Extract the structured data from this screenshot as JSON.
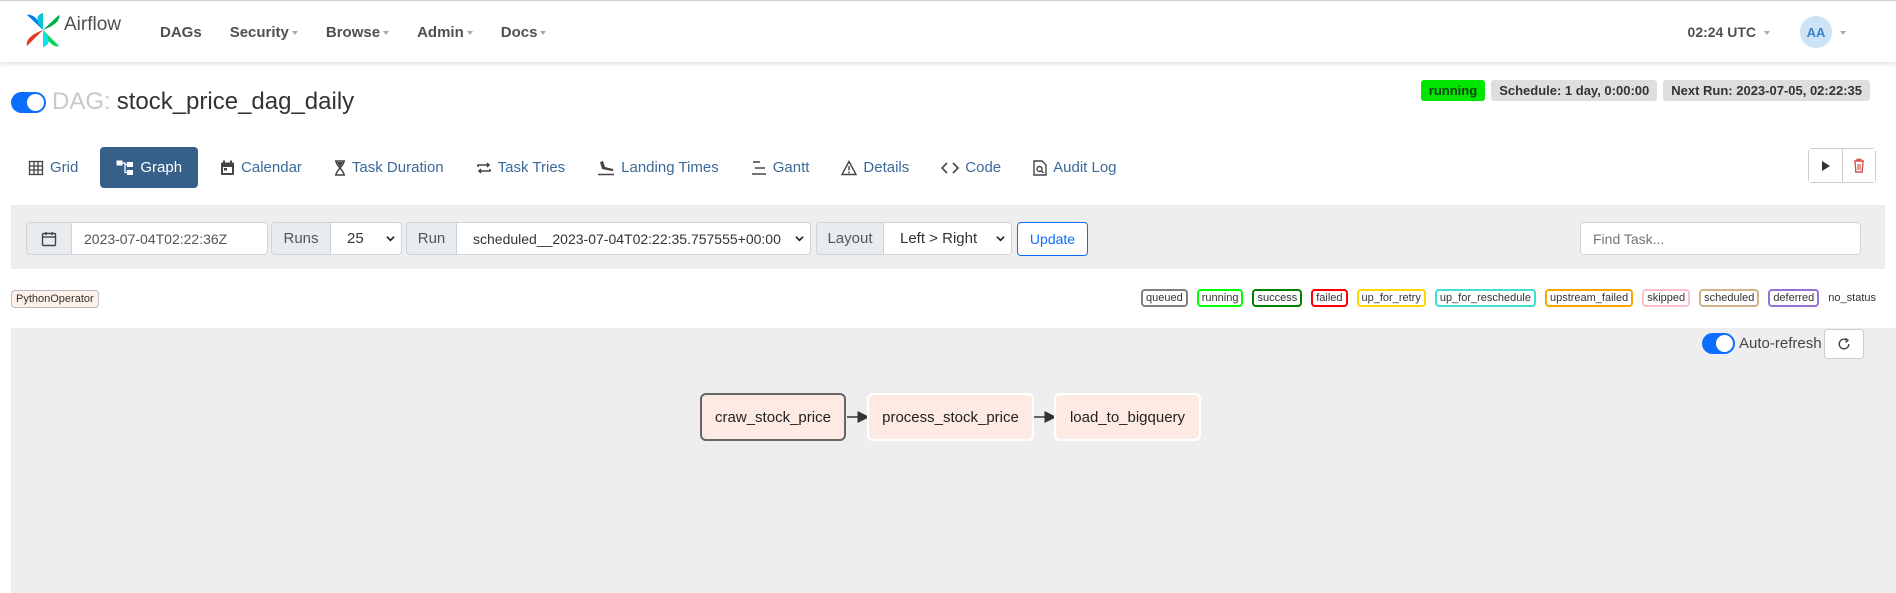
{
  "app": {
    "brand": "Airflow"
  },
  "nav": {
    "items": [
      {
        "label": "DAGs",
        "dropdown": false
      },
      {
        "label": "Security",
        "dropdown": true
      },
      {
        "label": "Browse",
        "dropdown": true
      },
      {
        "label": "Admin",
        "dropdown": true
      },
      {
        "label": "Docs",
        "dropdown": true
      }
    ],
    "clock": "02:24 UTC",
    "avatar_initials": "AA"
  },
  "dag": {
    "prefix": "DAG:",
    "name": "stock_price_dag_daily",
    "paused": false,
    "state_badge": "running",
    "schedule": "Schedule: 1 day, 0:00:00",
    "next_run": "Next Run: 2023-07-05, 02:22:35"
  },
  "tabs": [
    {
      "label": "Grid",
      "icon": "grid-icon",
      "active": false
    },
    {
      "label": "Graph",
      "icon": "graph-icon",
      "active": true
    },
    {
      "label": "Calendar",
      "icon": "calendar-icon",
      "active": false
    },
    {
      "label": "Task Duration",
      "icon": "hourglass-icon",
      "active": false
    },
    {
      "label": "Task Tries",
      "icon": "repeat-icon",
      "active": false
    },
    {
      "label": "Landing Times",
      "icon": "plane-landing-icon",
      "active": false
    },
    {
      "label": "Gantt",
      "icon": "gantt-icon",
      "active": false
    },
    {
      "label": "Details",
      "icon": "warning-triangle-icon",
      "active": false
    },
    {
      "label": "Code",
      "icon": "code-icon",
      "active": false
    },
    {
      "label": "Audit Log",
      "icon": "file-search-icon",
      "active": false
    }
  ],
  "filters": {
    "base_date": "2023-07-04T02:22:36Z",
    "runs_label": "Runs",
    "runs_value": "25",
    "run_label": "Run",
    "run_value": "scheduled__2023-07-04T02:22:35.757555+00:00",
    "layout_label": "Layout",
    "layout_value": "Left > Right",
    "update_label": "Update",
    "find_placeholder": "Find Task..."
  },
  "operator_tag": "PythonOperator",
  "legend": [
    {
      "label": "queued",
      "color": "#808080"
    },
    {
      "label": "running",
      "color": "#00ff00"
    },
    {
      "label": "success",
      "color": "#008000"
    },
    {
      "label": "failed",
      "color": "#ff0000"
    },
    {
      "label": "up_for_retry",
      "color": "#ffd700"
    },
    {
      "label": "up_for_reschedule",
      "color": "#40e0d0"
    },
    {
      "label": "upstream_failed",
      "color": "#ffa500"
    },
    {
      "label": "skipped",
      "color": "#ffc0cb"
    },
    {
      "label": "scheduled",
      "color": "#d2b48c"
    },
    {
      "label": "deferred",
      "color": "#9370db"
    },
    {
      "label": "no_status",
      "color": ""
    }
  ],
  "graph": {
    "auto_refresh_label": "Auto-refresh",
    "auto_refresh": true,
    "tasks": [
      {
        "id": "craw_stock_price",
        "selected": true
      },
      {
        "id": "process_stock_price",
        "selected": false
      },
      {
        "id": "load_to_bigquery",
        "selected": false
      }
    ]
  },
  "colors": {
    "accent": "#0d6efd",
    "active_tab": "#365f8a",
    "running_badge": "#00e600",
    "node_fill": "#fdebe3"
  }
}
